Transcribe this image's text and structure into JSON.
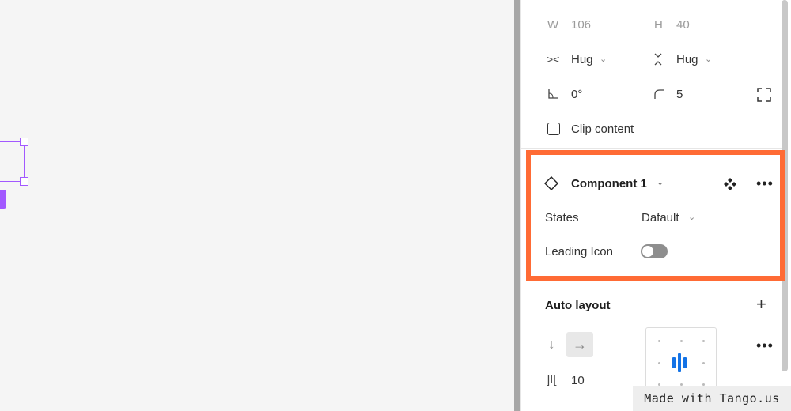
{
  "dimensions": {
    "w_label": "W",
    "w_value": "106",
    "h_label": "H",
    "h_value": "40",
    "width_mode": "Hug",
    "height_mode": "Hug",
    "rotation": "0°",
    "corner_radius": "5"
  },
  "clip_content": {
    "label": "Clip content",
    "checked": false
  },
  "component": {
    "name": "Component 1",
    "properties": [
      {
        "label": "States",
        "value": "Dafault"
      },
      {
        "label": "Leading Icon",
        "toggle": false
      }
    ]
  },
  "auto_layout": {
    "title": "Auto layout",
    "spacing": "10"
  },
  "watermark": "Made with Tango.us",
  "colors": {
    "highlight": "#ff6b35",
    "selection": "#a259ff",
    "align_accent": "#1473e6"
  },
  "icons": [
    "width-icon",
    "height-icon",
    "horizontal-resize-icon",
    "vertical-resize-icon",
    "rotation-icon",
    "corner-radius-icon",
    "independent-corners-icon",
    "component-diamond-icon",
    "component-instance-icon",
    "more-options-icon",
    "plus-icon",
    "arrow-down-icon",
    "arrow-right-icon",
    "gap-icon"
  ]
}
